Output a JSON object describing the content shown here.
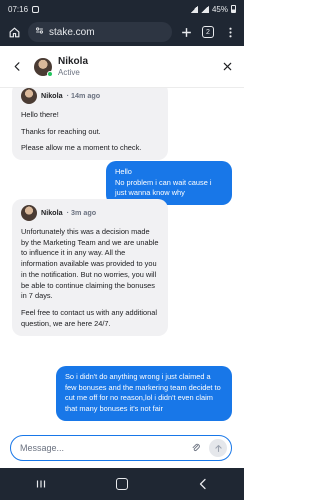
{
  "status_bar": {
    "time": "07:16",
    "battery": "45%"
  },
  "browser": {
    "url": "stake.com",
    "tab_count": "2",
    "home_icon": "home-icon",
    "add_icon": "plus-icon",
    "menu_icon": "more-vert-icon"
  },
  "chat_header": {
    "name": "Nikola",
    "status": "Active",
    "online_color": "#22c55e"
  },
  "messages": [
    {
      "direction": "incoming",
      "sender": "Nikola",
      "time": "14m ago",
      "paragraphs": [
        "Hello there!",
        "Thanks for reaching out.",
        "Please allow me a moment to check."
      ]
    },
    {
      "direction": "outgoing",
      "text": "Hello\nNo problem i can wait cause i just wanna know why"
    },
    {
      "direction": "incoming",
      "sender": "Nikola",
      "time": "3m ago",
      "paragraphs": [
        "Unfortunately this was a decision made by the Marketing Team and we are unable to influence it in any way. All the information available was provided to you in the notification. But no worries, you will be able to continue claiming the bonuses in 7 days.",
        "Feel free to contact us with any additional question, we are here 24/7."
      ]
    },
    {
      "direction": "outgoing",
      "text": "So i didn't do anything wrong i just claimed a few bonuses and the markering team decidet to cut me off for no reason,lol i didn't even claim that many bonuses it's not fair"
    }
  ],
  "composer": {
    "placeholder": "Message..."
  },
  "colors": {
    "accent": "#1877e8",
    "incoming_bubble": "#f1f1f3",
    "system_bar": "#1f2733"
  }
}
